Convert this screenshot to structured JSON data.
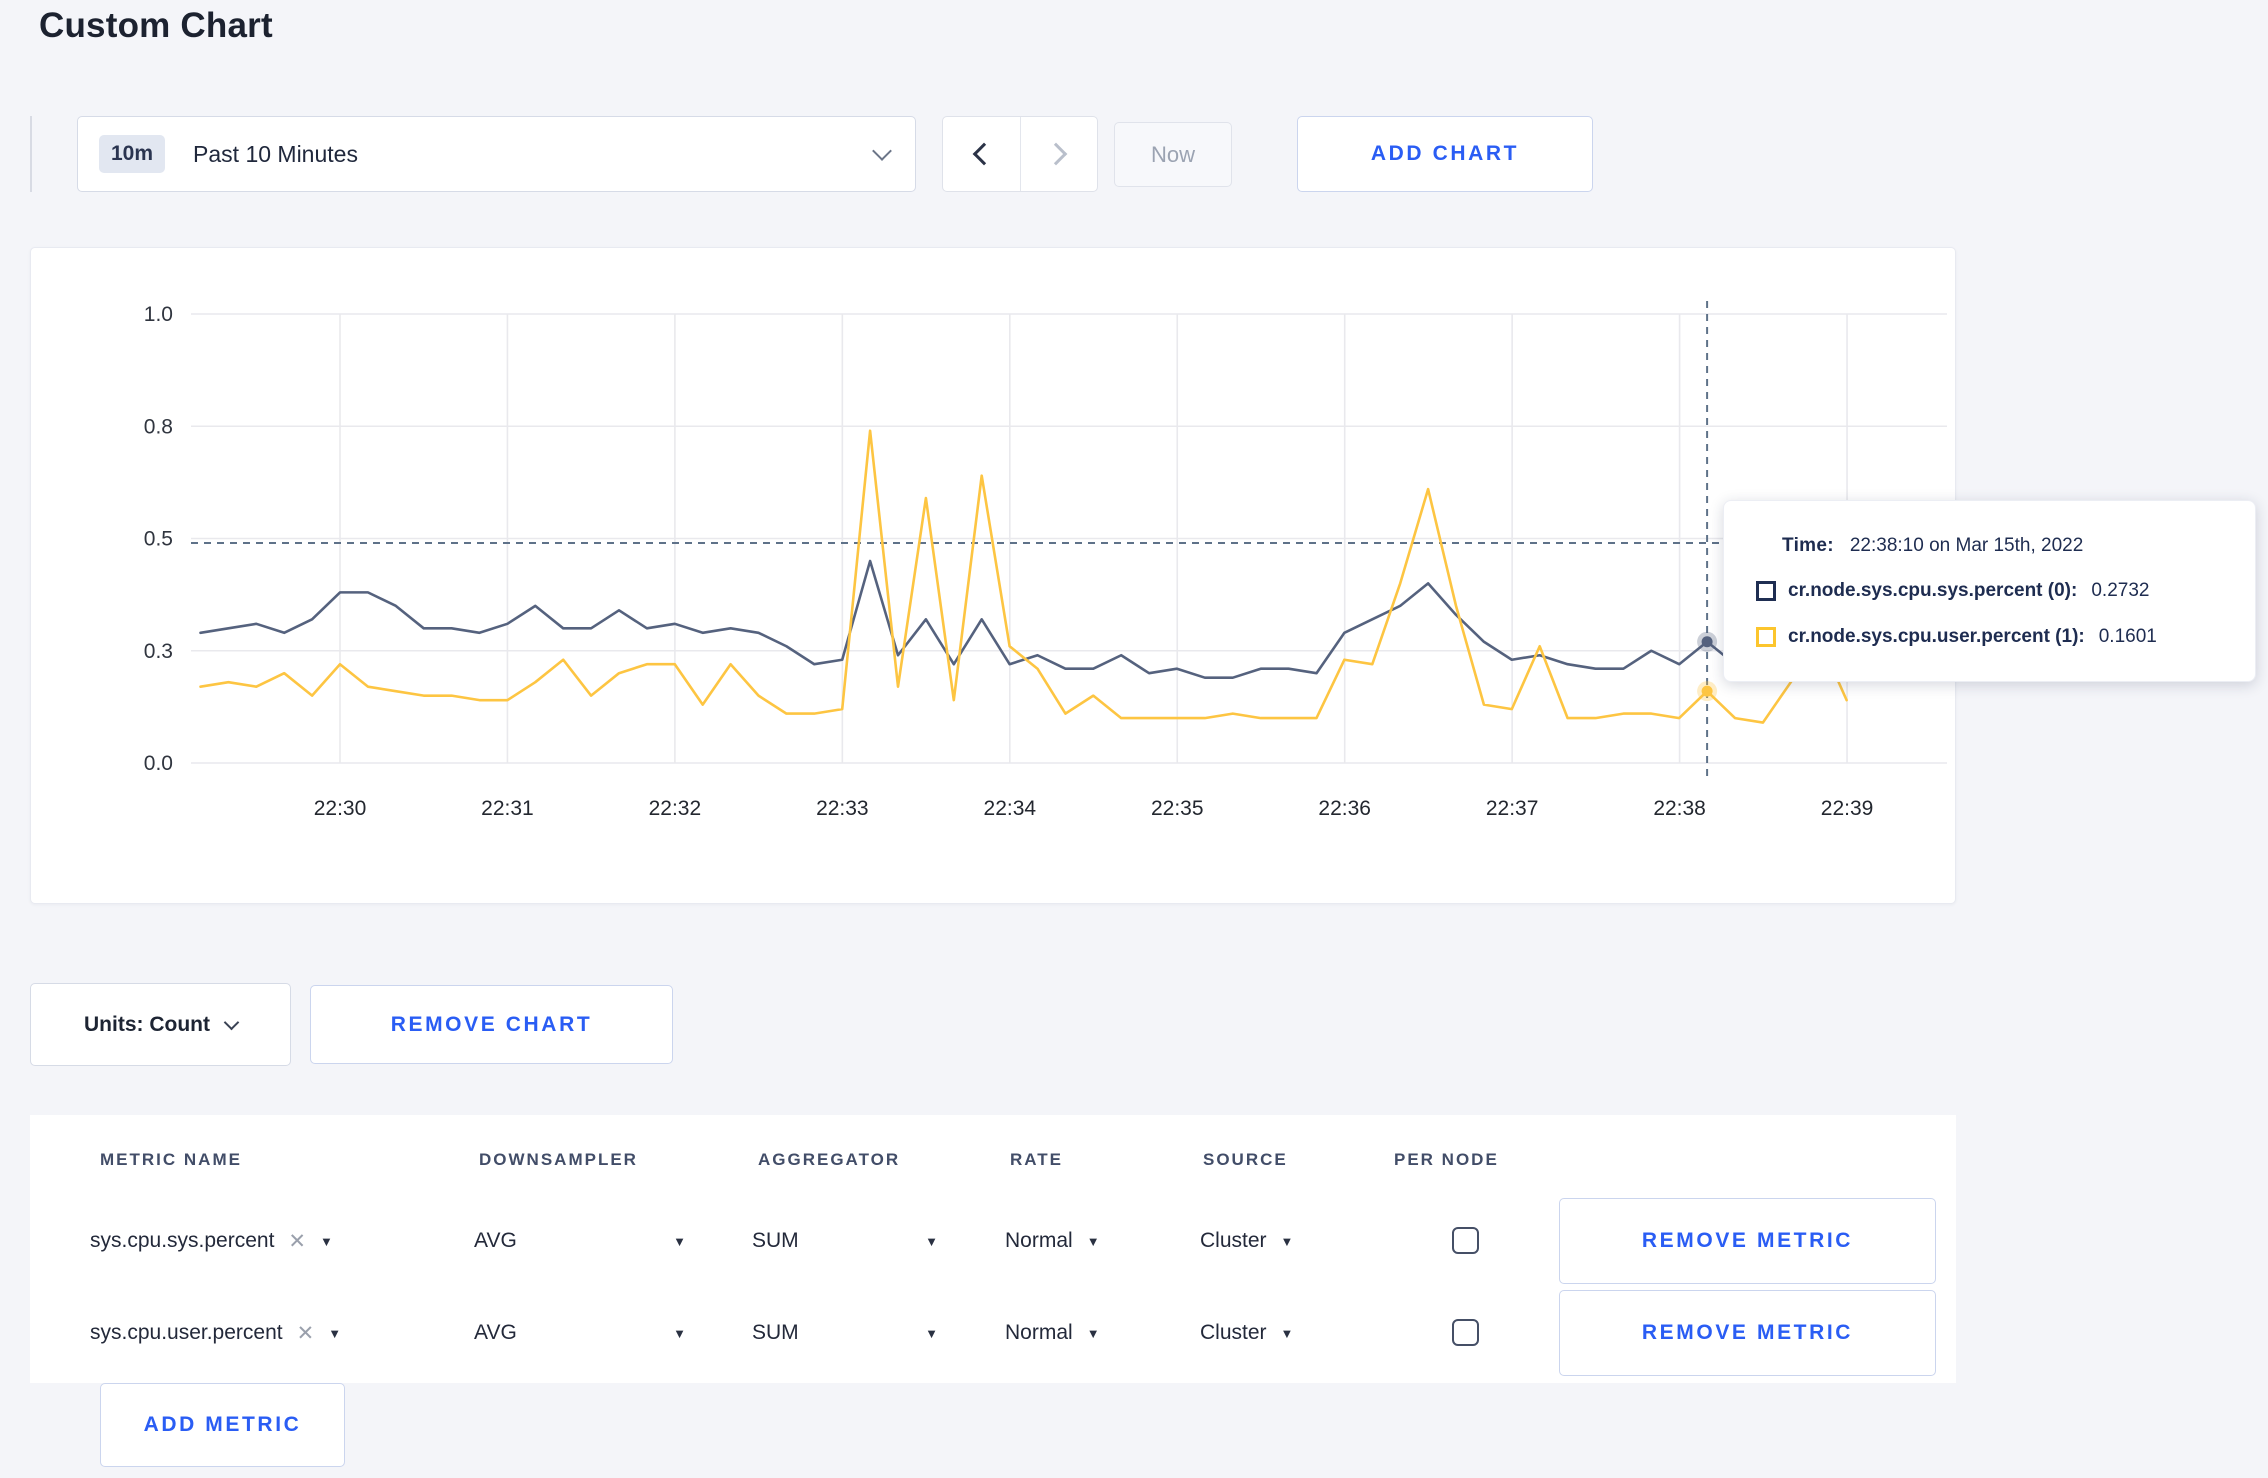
{
  "page": {
    "title": "Custom Chart"
  },
  "toolbar": {
    "time_window_badge": "10m",
    "time_window_label": "Past 10 Minutes",
    "now_label": "Now",
    "add_chart_label": "ADD CHART"
  },
  "chart_data": {
    "type": "line",
    "title": "",
    "xlabel": "",
    "ylabel": "",
    "ylim": [
      0,
      1
    ],
    "grid": true,
    "legend_position": "tooltip",
    "y_tick_labels": [
      "1.0",
      "0.8",
      "0.5",
      "0.3",
      "0.0"
    ],
    "y_tick_values": [
      1.0,
      0.75,
      0.5,
      0.25,
      0.0
    ],
    "x_tick_labels": [
      "22:30",
      "22:31",
      "22:32",
      "22:33",
      "22:34",
      "22:35",
      "22:36",
      "22:37",
      "22:38",
      "22:39"
    ],
    "x_start_time": "22:29:10",
    "x_interval_seconds": 10,
    "series": [
      {
        "name": "cr.node.sys.cpu.sys.percent (0)",
        "color": "#55627e",
        "values": [
          0.29,
          0.3,
          0.31,
          0.29,
          0.32,
          0.38,
          0.38,
          0.35,
          0.3,
          0.3,
          0.29,
          0.31,
          0.35,
          0.3,
          0.3,
          0.34,
          0.3,
          0.31,
          0.29,
          0.3,
          0.29,
          0.26,
          0.22,
          0.23,
          0.45,
          0.24,
          0.32,
          0.22,
          0.32,
          0.22,
          0.24,
          0.21,
          0.21,
          0.24,
          0.2,
          0.21,
          0.19,
          0.19,
          0.21,
          0.21,
          0.2,
          0.29,
          0.32,
          0.35,
          0.4,
          0.33,
          0.27,
          0.23,
          0.24,
          0.22,
          0.21,
          0.21,
          0.25,
          0.22,
          0.27,
          0.22,
          0.24,
          0.25,
          0.24,
          0.26
        ]
      },
      {
        "name": "cr.node.sys.cpu.user.percent (1)",
        "color": "#fdc542",
        "values": [
          0.17,
          0.18,
          0.17,
          0.2,
          0.15,
          0.22,
          0.17,
          0.16,
          0.15,
          0.15,
          0.14,
          0.14,
          0.18,
          0.23,
          0.15,
          0.2,
          0.22,
          0.22,
          0.13,
          0.22,
          0.15,
          0.11,
          0.11,
          0.12,
          0.74,
          0.17,
          0.59,
          0.14,
          0.64,
          0.26,
          0.21,
          0.11,
          0.15,
          0.1,
          0.1,
          0.1,
          0.1,
          0.11,
          0.1,
          0.1,
          0.1,
          0.23,
          0.22,
          0.4,
          0.61,
          0.35,
          0.13,
          0.12,
          0.26,
          0.1,
          0.1,
          0.11,
          0.11,
          0.1,
          0.16,
          0.1,
          0.09,
          0.18,
          0.28,
          0.14
        ]
      }
    ],
    "crosshair": {
      "hover_index": 54,
      "guide_value": 0.49
    }
  },
  "tooltip": {
    "time_label": "Time:",
    "time_value": "22:38:10 on Mar 15th, 2022",
    "rows": [
      {
        "metric": "cr.node.sys.cpu.sys.percent (0):",
        "value": "0.2732",
        "swatch_color": "#1f2e52"
      },
      {
        "metric": "cr.node.sys.cpu.user.percent (1):",
        "value": "0.1601",
        "swatch_color": "#fcc52d"
      }
    ]
  },
  "actions": {
    "units_label": "Units: Count",
    "remove_chart_label": "REMOVE CHART"
  },
  "metrics_table": {
    "headers": [
      "METRIC NAME",
      "DOWNSAMPLER",
      "AGGREGATOR",
      "RATE",
      "SOURCE",
      "PER NODE"
    ],
    "rows": [
      {
        "metric": "sys.cpu.sys.percent",
        "downsampler": "AVG",
        "aggregator": "SUM",
        "rate": "Normal",
        "source": "Cluster",
        "per_node_checked": false,
        "remove_label": "REMOVE METRIC"
      },
      {
        "metric": "sys.cpu.user.percent",
        "downsampler": "AVG",
        "aggregator": "SUM",
        "rate": "Normal",
        "source": "Cluster",
        "per_node_checked": false,
        "remove_label": "REMOVE METRIC"
      }
    ],
    "add_metric_label": "ADD METRIC"
  },
  "colors": {
    "accent_blue": "#2a5df4",
    "guide_dash": "#5f7289",
    "gridline": "#e9e9ed",
    "axis_text": "#30353f"
  }
}
